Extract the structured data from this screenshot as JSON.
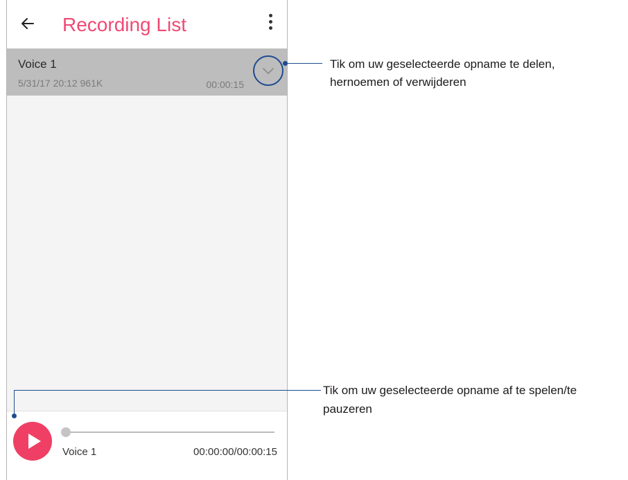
{
  "app_bar": {
    "title": "Recording List",
    "back_icon": "arrow-left-icon",
    "menu_icon": "more-vertical-icon"
  },
  "recordings": [
    {
      "name": "Voice 1",
      "meta": "5/31/17 20:12  961K",
      "duration": "00:00:15",
      "expand_icon": "chevron-down-icon"
    }
  ],
  "player": {
    "play_icon": "play-icon",
    "track_name": "Voice 1",
    "time": "00:00:00/00:00:15",
    "progress": 0
  },
  "callouts": {
    "share_rename_delete": "Tik om uw geselecteerde opname te delen, hernoemen of verwijderen",
    "play_pause_line1": "Tik om uw geselecteerde opname af te spelen/te",
    "play_pause_line2": "pauzeren"
  },
  "colors": {
    "accent": "#ef4a74",
    "play_button": "#ef3f64",
    "selected_row": "#bdbdbd",
    "callout": "#1e4b8f"
  }
}
